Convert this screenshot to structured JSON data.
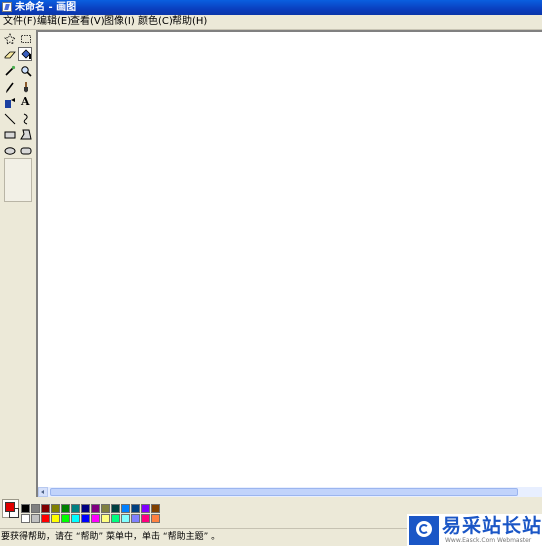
{
  "window": {
    "title": "未命名 - 画图"
  },
  "menu": [
    "文件(F)",
    "编辑(E)",
    "查看(V)",
    "图像(I)",
    "颜色(C)",
    "帮助(H)"
  ],
  "tools": [
    {
      "name": "free-form-select-tool",
      "icon": "star-select-icon"
    },
    {
      "name": "select-tool",
      "icon": "rect-select-icon"
    },
    {
      "name": "eraser-tool",
      "icon": "eraser-icon"
    },
    {
      "name": "fill-tool",
      "icon": "paint-bucket-icon",
      "selected": true
    },
    {
      "name": "pick-color-tool",
      "icon": "eyedropper-icon"
    },
    {
      "name": "magnifier-tool",
      "icon": "magnifier-icon"
    },
    {
      "name": "pencil-tool",
      "icon": "pencil-icon"
    },
    {
      "name": "brush-tool",
      "icon": "brush-icon"
    },
    {
      "name": "airbrush-tool",
      "icon": "airbrush-icon"
    },
    {
      "name": "text-tool",
      "icon": "text-a-icon",
      "label": "A"
    },
    {
      "name": "line-tool",
      "icon": "line-icon"
    },
    {
      "name": "curve-tool",
      "icon": "curve-icon"
    },
    {
      "name": "rectangle-tool",
      "icon": "rectangle-icon"
    },
    {
      "name": "polygon-tool",
      "icon": "polygon-icon"
    },
    {
      "name": "ellipse-tool",
      "icon": "ellipse-icon"
    },
    {
      "name": "rounded-rectangle-tool",
      "icon": "rounded-rectangle-icon"
    }
  ],
  "colors": {
    "foreground": "#e00000",
    "background": "#ffffff",
    "palette_top": [
      "#000000",
      "#808080",
      "#800000",
      "#808000",
      "#008000",
      "#008080",
      "#000080",
      "#800080",
      "#808040",
      "#004040",
      "#0080ff",
      "#004080",
      "#8000ff",
      "#804000"
    ],
    "palette_bottom": [
      "#ffffff",
      "#c0c0c0",
      "#ff0000",
      "#ffff00",
      "#00ff00",
      "#00ffff",
      "#0000ff",
      "#ff00ff",
      "#ffff80",
      "#00ff80",
      "#80ffff",
      "#8080ff",
      "#ff0080",
      "#ff8040"
    ]
  },
  "status": {
    "text": "要获得帮助，请在 “帮助” 菜单中，单击 “帮助主题” 。"
  },
  "watermark": {
    "brand": "易采站长站",
    "url": "Www.Easck.Com  Webmaster"
  }
}
